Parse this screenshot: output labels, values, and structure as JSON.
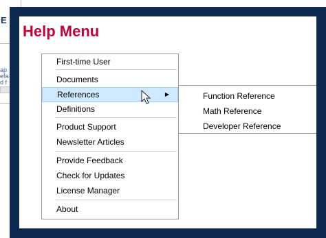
{
  "background_window": {
    "title_char": "E",
    "text_lines": [
      "ap",
      "efa",
      "d f"
    ]
  },
  "panel": {
    "title": "Help Menu",
    "frame_color": "#0f2a52",
    "title_color": "#c0003a"
  },
  "menu": {
    "items": [
      {
        "label": "First-time User"
      },
      {
        "label": "Documents"
      },
      {
        "label": "References",
        "highlighted": true,
        "has_submenu": true,
        "arrow": "▶"
      },
      {
        "label": "Definitions"
      },
      {
        "label": "Product Support"
      },
      {
        "label": "Newsletter Articles"
      },
      {
        "label": "Provide Feedback"
      },
      {
        "label": "Check for Updates"
      },
      {
        "label": "License Manager"
      },
      {
        "label": "About"
      }
    ],
    "highlight_color": "#cde8ff"
  },
  "submenu": {
    "items": [
      {
        "label": "Function Reference"
      },
      {
        "label": "Math Reference"
      },
      {
        "label": "Developer Reference"
      }
    ]
  }
}
